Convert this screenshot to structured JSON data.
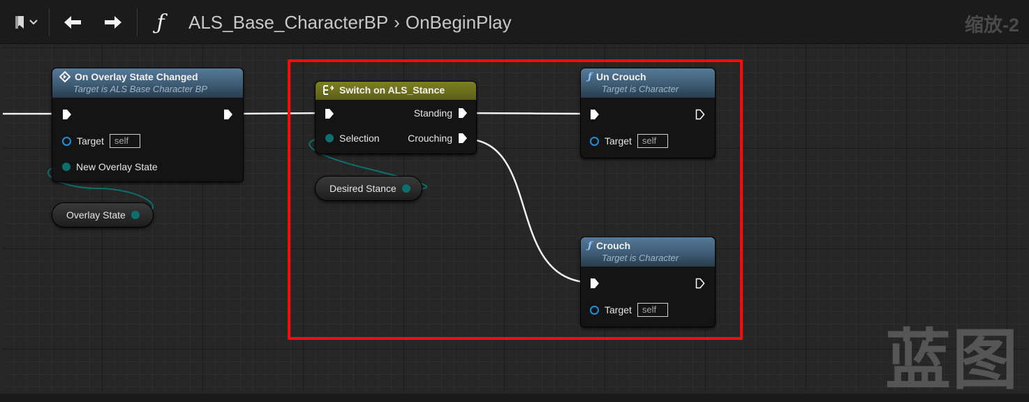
{
  "toolbar": {
    "bookmark_icon": "bookmark-icon",
    "dropdown_icon": "chevron-down-icon",
    "back_icon": "arrow-left-icon",
    "forward_icon": "arrow-right-icon",
    "function_icon": "function-icon",
    "breadcrumb": [
      "ALS_Base_CharacterBP",
      "OnBeginPlay"
    ],
    "zoom": "缩放-2"
  },
  "nodes": {
    "overlay_changed": {
      "title": "On Overlay State Changed",
      "subtitle": "Target is ALS Base Character BP",
      "target_label": "Target",
      "target_value": "self",
      "param_label": "New Overlay State"
    },
    "overlay_state_var": {
      "label": "Overlay State"
    },
    "switch_stance": {
      "title": "Switch on ALS_Stance",
      "selection_label": "Selection",
      "out1": "Standing",
      "out2": "Crouching"
    },
    "desired_stance_var": {
      "label": "Desired Stance"
    },
    "un_crouch": {
      "title": "Un Crouch",
      "subtitle": "Target is Character",
      "target_label": "Target",
      "target_value": "self"
    },
    "crouch": {
      "title": "Crouch",
      "subtitle": "Target is Character",
      "target_label": "Target",
      "target_value": "self"
    }
  },
  "watermark": "蓝图",
  "colors": {
    "highlight": "#ff0a0a",
    "function_header": "#3b5870",
    "switch_header": "#6b6d1c",
    "enum_pin": "#0d6e6e",
    "object_pin": "#1e8fdc"
  }
}
